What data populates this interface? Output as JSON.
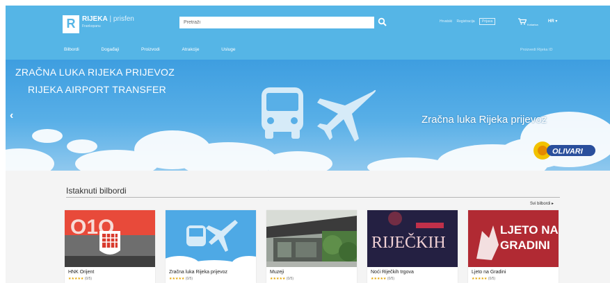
{
  "header": {
    "logo_letter": "R",
    "brand": "RIJEKA",
    "brand_suffix": "| prisfen",
    "tagline": "Frankopanu",
    "search_placeholder": "Pretraži",
    "links": [
      "Hrvatski",
      "Registracija",
      "Prijava"
    ],
    "cart_label": "Košarica",
    "language": "HR ▾",
    "colors": {
      "bar": "#55b5e6"
    }
  },
  "nav": {
    "items": [
      "Bilbordi",
      "Događaji",
      "Proizvodi",
      "Atrakcije",
      "Usluge"
    ],
    "right_link": "Proizvedi Rijeka ID"
  },
  "hero": {
    "line1": "ZRAČNA LUKA RIJEKA PRIJEVOZ",
    "line2": "RIJEKA AIRPORT TRANSFER",
    "caption": "Zračna luka Rijeka prijevoz",
    "sponsor_logo": "OLIVARI",
    "prev_arrow": "‹"
  },
  "featured": {
    "title": "Istaknuti bilbordi",
    "see_all": "Svi bilbordi ▸",
    "cards": [
      {
        "title": "HNK Orijent",
        "stars": "★★★★★",
        "count": "(0/5)",
        "thumb_text": "O1O"
      },
      {
        "title": "Zračna luka Rijeka prijevoz",
        "stars": "★★★★★",
        "count": "(0/5)",
        "thumb_text": ""
      },
      {
        "title": "Muzeji",
        "stars": "★★★★★",
        "count": "(0/5)",
        "thumb_text": ""
      },
      {
        "title": "Noći Riječkih trgova",
        "stars": "★★★★★",
        "count": "(0/5)",
        "thumb_text": "RIJEČKIH"
      },
      {
        "title": "Ljeto na Gradini",
        "stars": "★★★★★",
        "count": "(0/5)",
        "thumb_text": "LJETO NA GRADINI"
      }
    ]
  }
}
